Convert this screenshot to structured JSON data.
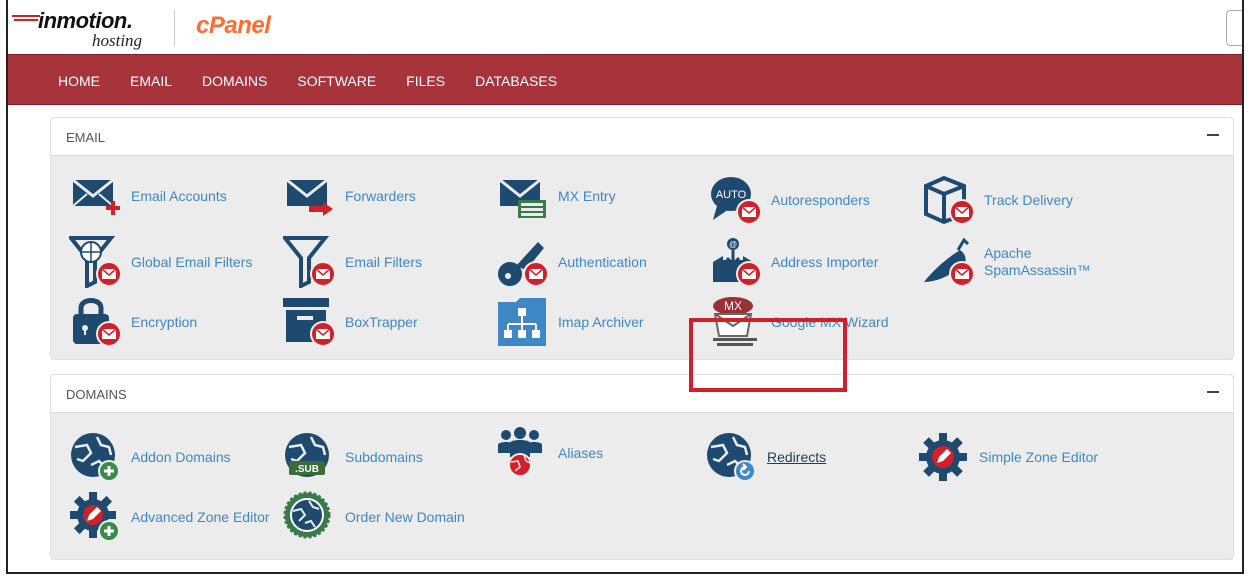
{
  "header": {
    "brand_main": "inmotion.",
    "brand_sub": "hosting",
    "product": "cPanel"
  },
  "nav": {
    "items": [
      "HOME",
      "EMAIL",
      "DOMAINS",
      "SOFTWARE",
      "FILES",
      "DATABASES"
    ]
  },
  "email": {
    "title": "EMAIL",
    "items": {
      "email_accounts": "Email Accounts",
      "forwarders": "Forwarders",
      "mx_entry": "MX Entry",
      "autoresponders": "Autoresponders",
      "auto_badge": "AUTO",
      "track_delivery": "Track Delivery",
      "global_email_filters": "Global Email Filters",
      "email_filters": "Email Filters",
      "authentication": "Authentication",
      "address_importer": "Address Importer",
      "apache_spamassassin_1": "Apache",
      "apache_spamassassin_2": "SpamAssassin™",
      "encryption": "Encryption",
      "boxtrapper": "BoxTrapper",
      "imap_archiver": "Imap Archiver",
      "google_mx_wizard": "Google MX Wizard",
      "mx_badge": "MX"
    }
  },
  "domains": {
    "title": "DOMAINS",
    "items": {
      "addon_domains": "Addon Domains",
      "subdomains": "Subdomains",
      "sub_badge": ".SUB",
      "aliases": "Aliases",
      "redirects": "Redirects",
      "simple_zone_editor": "Simple Zone Editor",
      "advanced_zone_editor": "Advanced Zone Editor",
      "order_new_domain": "Order New Domain"
    }
  },
  "colors": {
    "nav_bg": "#a6343a",
    "icon_navy": "#1d4a6e",
    "link_blue": "#3f87c5",
    "badge_red": "#d0202a",
    "highlight_red": "#d0202a",
    "cpanel_orange": "#ff6c2c"
  }
}
